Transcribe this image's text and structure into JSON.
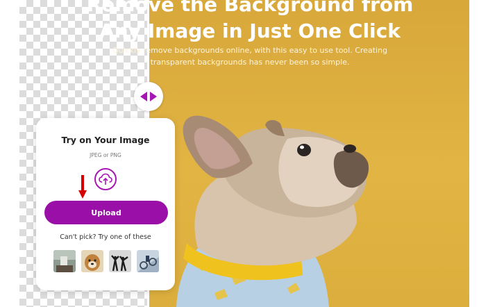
{
  "hero": {
    "title_line1": "Remove the Background from",
    "title_line2": "Any Image in Just One Click",
    "subtitle_line1": "Quickly remove backgrounds online, with this easy to use tool. Creating",
    "subtitle_line2": "transparent backgrounds has never been so simple."
  },
  "comparison_handle": {
    "icon": "left-right-arrows-icon"
  },
  "upload_card": {
    "title": "Try on Your Image",
    "formats": "JPEG or PNG",
    "upload_icon": "cloud-upload-icon",
    "upload_button_label": "Upload",
    "alt_label": "Can't pick? Try one of these",
    "samples": [
      "sample-room",
      "sample-dog",
      "sample-dancers",
      "sample-bikes"
    ]
  },
  "colors": {
    "brand_purple": "#9a0fa8",
    "background_yellow": "#dcae3d",
    "annotation_red": "#d60000"
  }
}
